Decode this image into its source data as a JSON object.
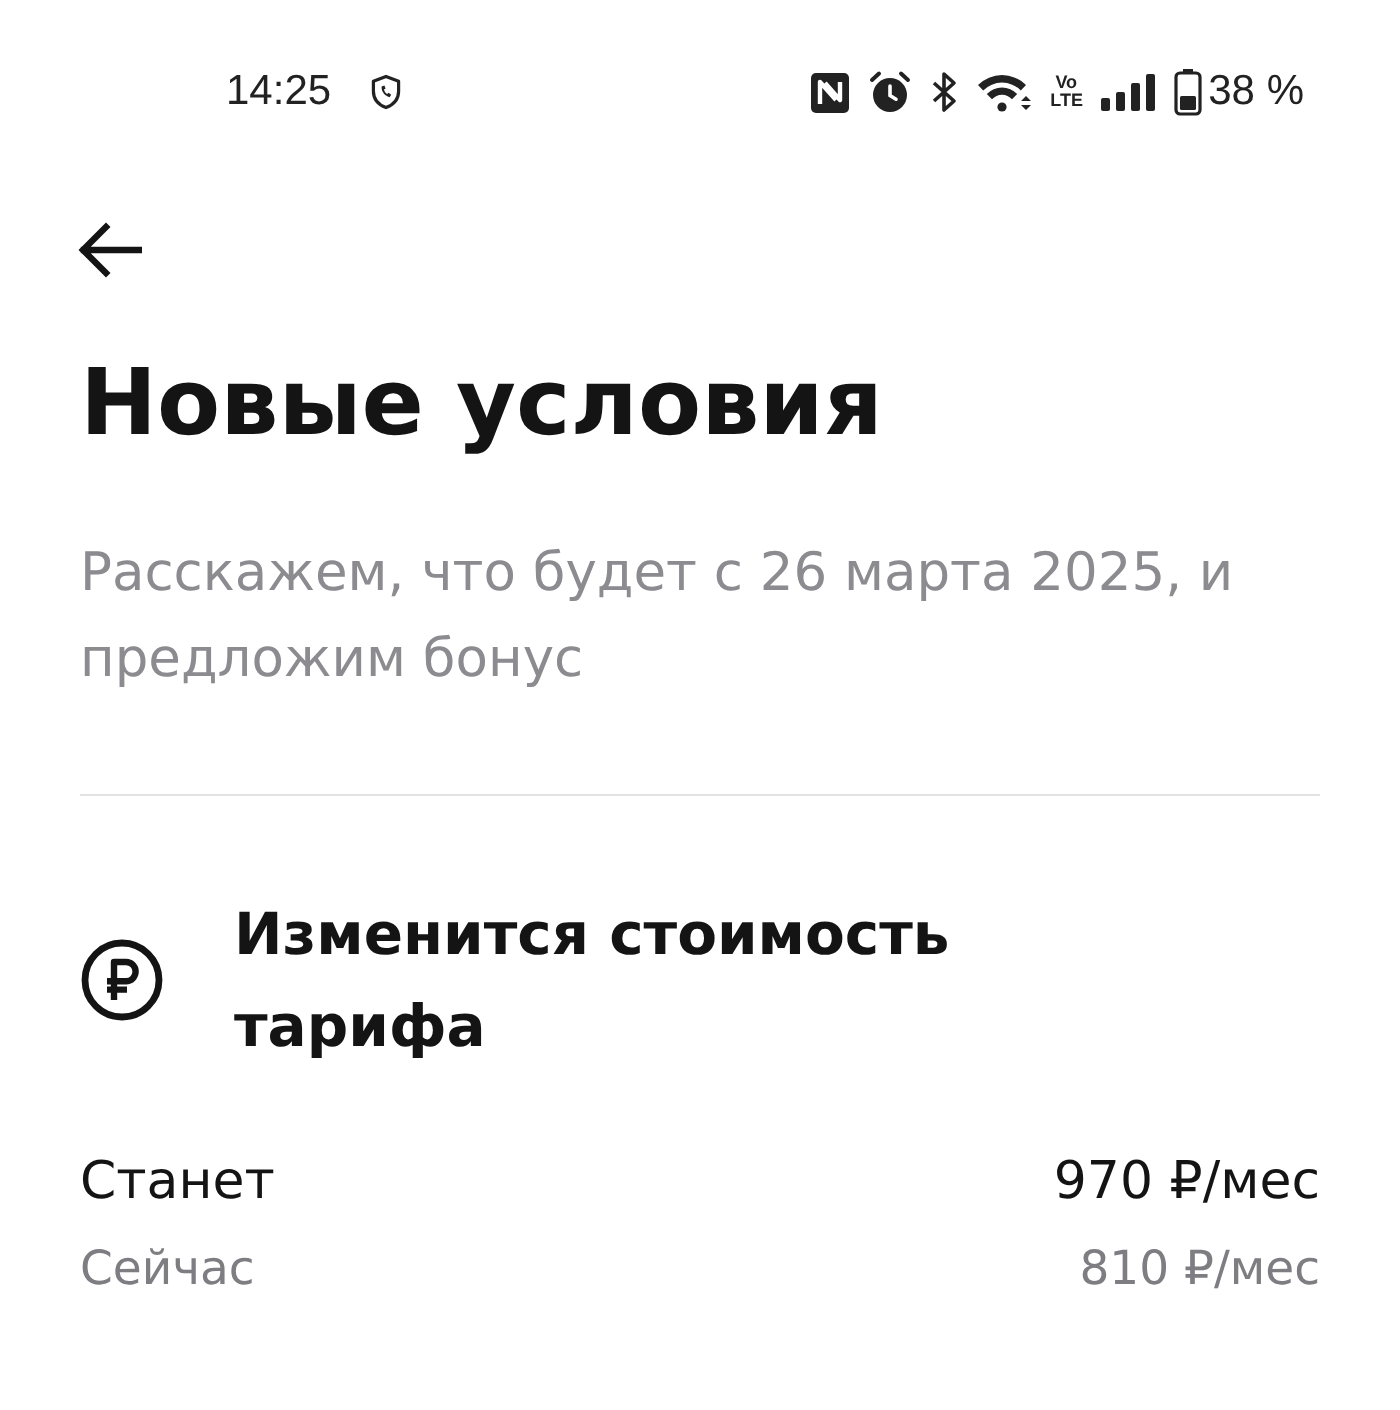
{
  "status_bar": {
    "time": "14:25",
    "volte": "Vo LTE",
    "battery": "38 %"
  },
  "header": {
    "title": "Новые условия",
    "subtitle": "Расскажем, что будет с 26 марта 2025, и предложим бонус"
  },
  "section": {
    "title": "Изменится стоимость тарифа",
    "rows": [
      {
        "kind": "new",
        "label": "Станет",
        "value": "970 ₽/мес"
      },
      {
        "kind": "current",
        "label": "Сейчас",
        "value": "810 ₽/мес"
      }
    ]
  }
}
